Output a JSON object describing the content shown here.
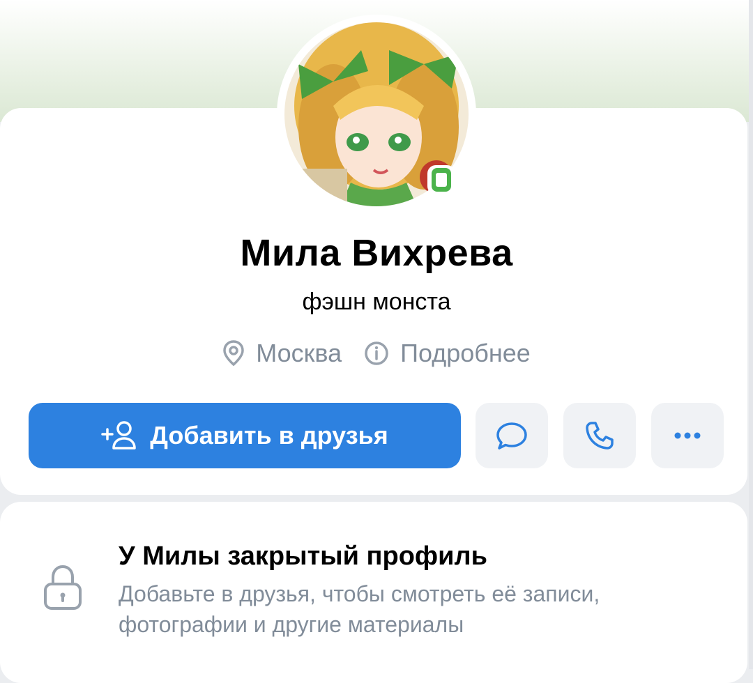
{
  "profile": {
    "name": "Мила Вихрева",
    "status": "фэшн монста",
    "city": "Москва",
    "more_info": "Подробнее",
    "avatar_alt": "avatar",
    "online_badge": "mobile-online-badge"
  },
  "actions": {
    "add_friend": "Добавить в друзья",
    "message_icon": "chat-bubble-icon",
    "call_icon": "phone-icon",
    "more_icon": "more-dots-icon"
  },
  "closed_profile": {
    "title": "У Милы закрытый профиль",
    "description": "Добавьте в друзья, чтобы смотреть её записи, фотографии и другие материалы"
  },
  "colors": {
    "accent": "#2d81e0",
    "secondary_text": "#818c99",
    "online": "#4bb34b",
    "button_bg": "#f0f2f5"
  }
}
